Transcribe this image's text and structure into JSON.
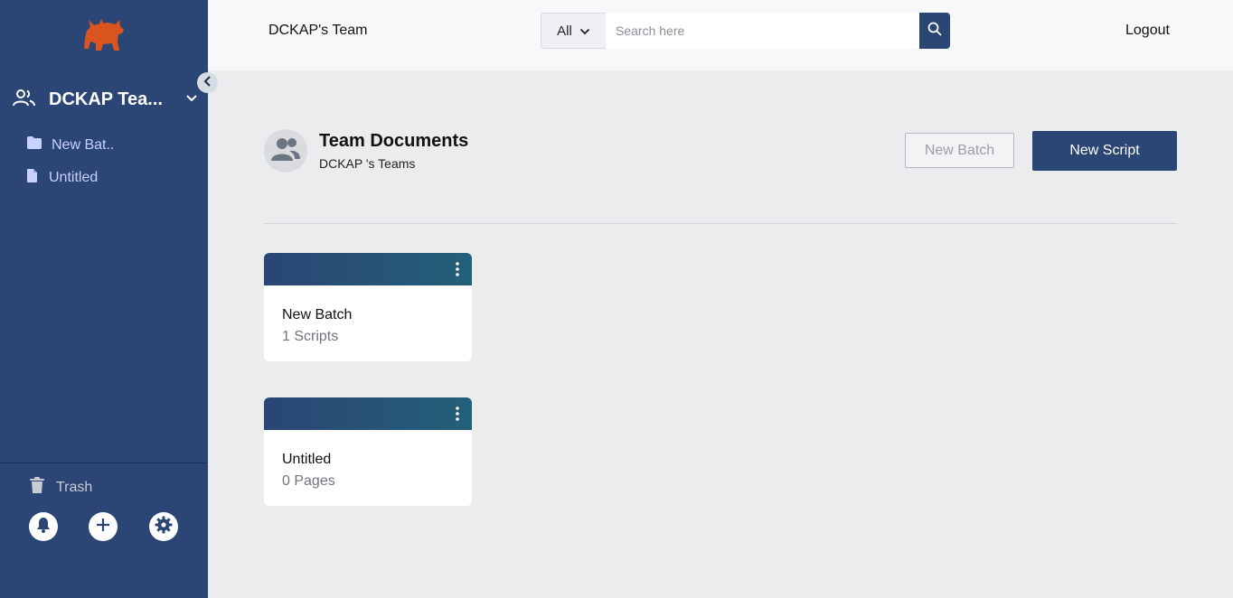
{
  "sidebar": {
    "team_name": "DCKAP Tea...",
    "items": [
      {
        "label": "New Bat..",
        "icon": "folder-icon"
      },
      {
        "label": "Untitled",
        "icon": "file-icon"
      }
    ],
    "trash_label": "Trash",
    "bottom_buttons": [
      "bell-icon",
      "plus-icon",
      "gear-icon"
    ]
  },
  "header": {
    "team_title": "DCKAP's Team",
    "search": {
      "scope": "All",
      "placeholder": "Search here"
    },
    "logout_label": "Logout"
  },
  "main": {
    "title": "Team Documents",
    "subtitle": "DCKAP 's Teams",
    "new_batch_label": "New Batch",
    "new_script_label": "New Script",
    "cards": [
      {
        "name": "New Batch",
        "count": "1 Scripts"
      },
      {
        "name": "Untitled",
        "count": "0 Pages"
      }
    ]
  },
  "colors": {
    "sidebar_bg": "#2b4574",
    "accent": "#2b4574",
    "logo": "#d9541e",
    "page_bg": "#ebecee"
  }
}
